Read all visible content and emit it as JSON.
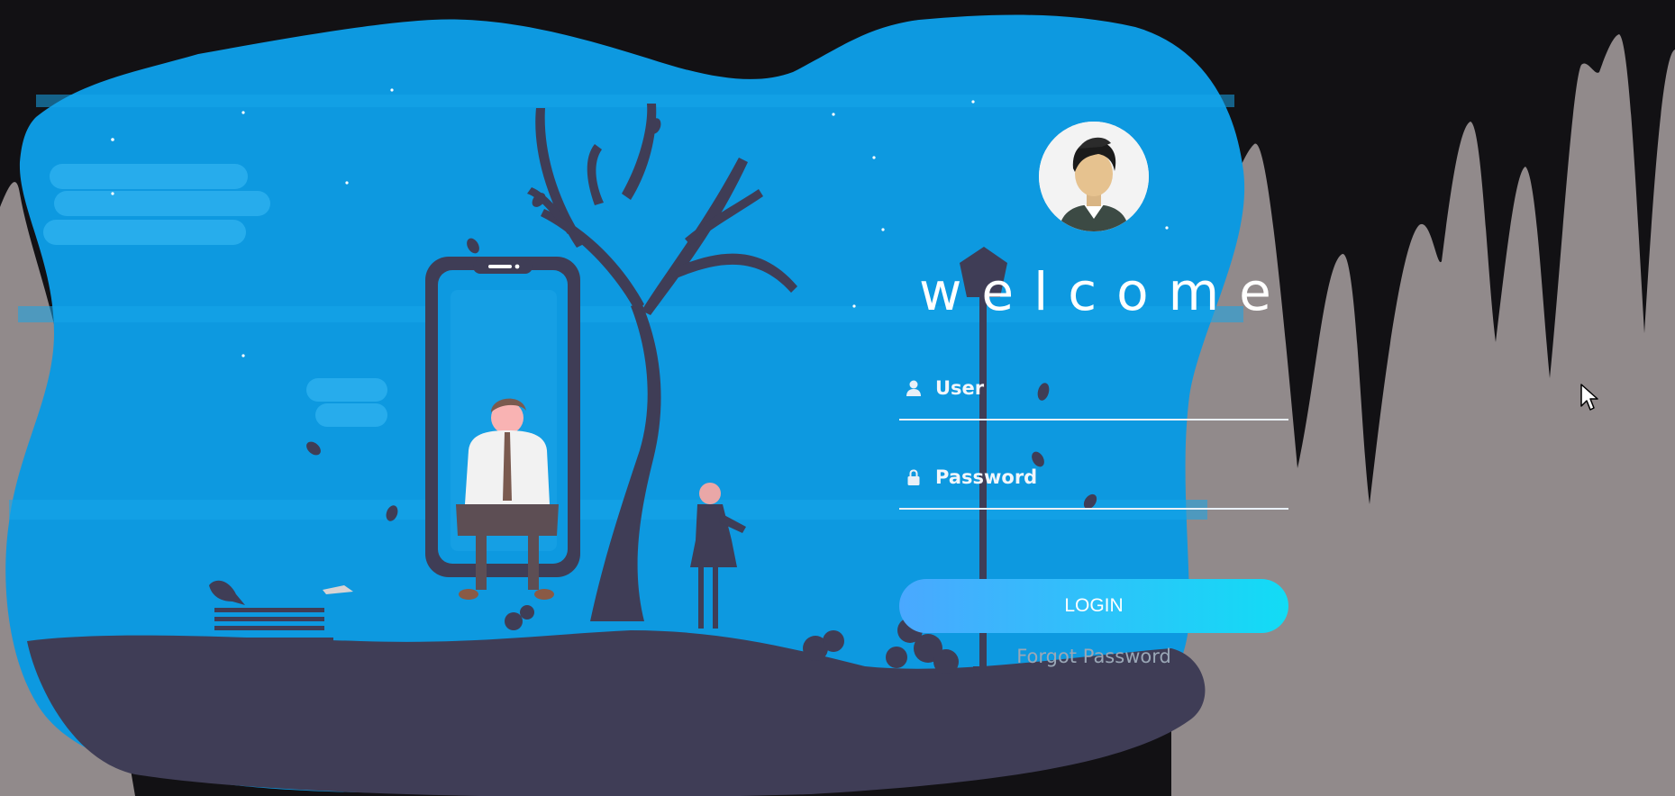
{
  "login": {
    "heading": "welcome",
    "user_placeholder": "User",
    "password_placeholder": "Password",
    "login_label": "LOGIN",
    "forgot_label": "Forgot Password"
  },
  "icons": {
    "avatar": "man-avatar-icon",
    "user": "user-icon",
    "password": "lock-icon",
    "cursor": "mouse-cursor-icon"
  },
  "colors": {
    "background": "#121114",
    "blob": "#0d99e0",
    "ground": "#3f3d56",
    "mountains": "#918a8b",
    "button_start": "#4aa8ff",
    "button_end": "#12dcf5"
  }
}
